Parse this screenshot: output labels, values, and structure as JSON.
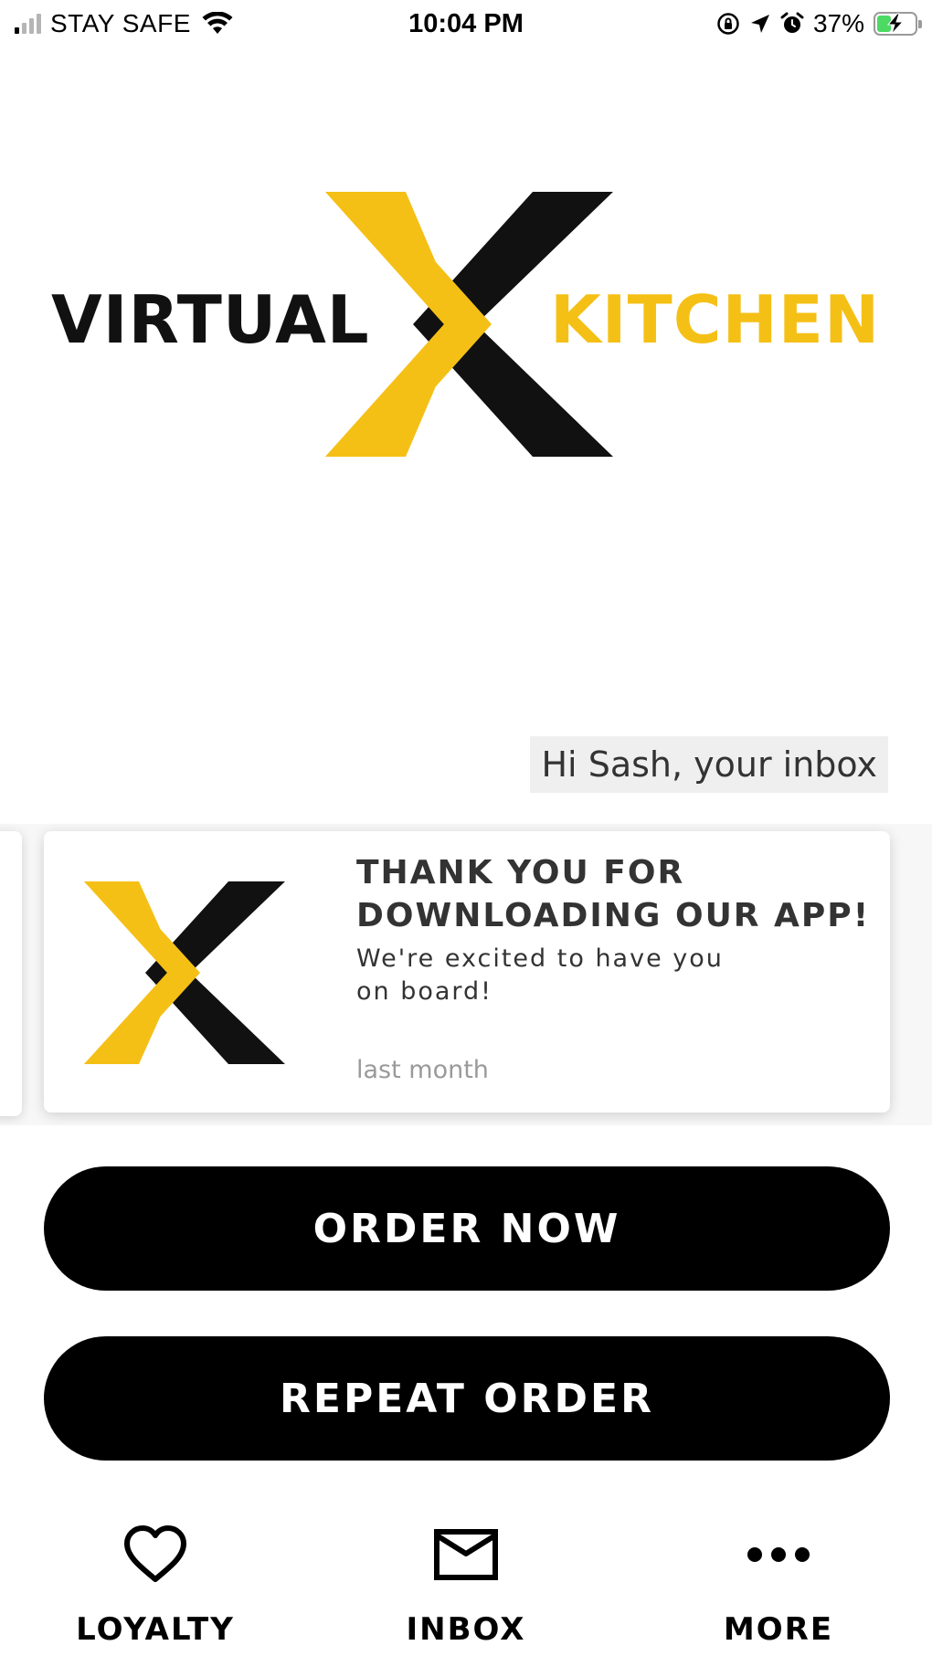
{
  "status_bar": {
    "carrier": "STAY SAFE",
    "time": "10:04 PM",
    "battery": "37%",
    "battery_level": 0.37,
    "battery_color": "#4cd964"
  },
  "logo": {
    "word_left": "VIRTUAL",
    "word_right": "KITCHEN",
    "mark_icon": "x-logo-icon",
    "colors": {
      "yellow": "#f5c016",
      "black": "#111111"
    }
  },
  "inbox": {
    "greeting": "Hi Sash, your inbox",
    "messages": [
      {
        "title": "THANK YOU FOR DOWNLOADING OUR APP!",
        "text": "We're excited to have you on board!",
        "time": "last month",
        "thumb_icon": "x-logo-icon"
      }
    ]
  },
  "actions": {
    "order_now": "ORDER NOW",
    "repeat_order": "REPEAT ORDER"
  },
  "tabs": [
    {
      "label": "LOYALTY",
      "icon": "heart-icon"
    },
    {
      "label": "INBOX",
      "icon": "envelope-icon"
    },
    {
      "label": "MORE",
      "icon": "more-dots-icon"
    }
  ]
}
